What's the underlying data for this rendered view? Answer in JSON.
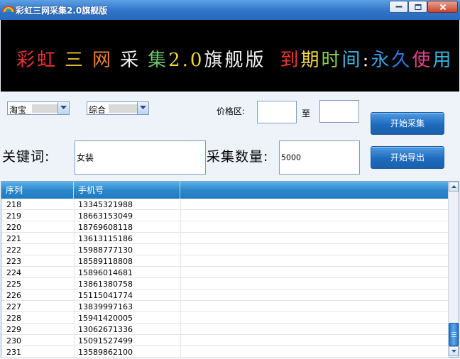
{
  "window": {
    "title": "彩虹三网采集2.0旗舰版"
  },
  "banner": {
    "chars": [
      "彩",
      "虹",
      " ",
      "三",
      " ",
      "网",
      " ",
      "采",
      " ",
      "集",
      "2",
      ".",
      "0",
      "旗",
      "舰",
      "版",
      " ",
      " ",
      "到",
      "期",
      "时",
      "间",
      ":",
      "永",
      "久",
      "使",
      "用"
    ],
    "colors": [
      "#e8322f",
      "#e8322f",
      "#000",
      "#d8b630",
      "#000",
      "#f07e31",
      "#000",
      "#f0f0f0",
      "#000",
      "#6fc36d",
      "#f3d637",
      "#f3d637",
      "#f3d637",
      "#f0f0f0",
      "#f0f0f0",
      "#f0f0f0",
      "#000",
      "#000",
      "#ea3a35",
      "#f4d63a",
      "#8fd24a",
      "#3fb6e5",
      ":",
      "#3b9ee0",
      "#2d7ce0",
      "#e0438a",
      "#3ab3e0"
    ]
  },
  "filters": {
    "platform": "淘宝",
    "category": "综合",
    "price_label": "价格区:",
    "price_min": "",
    "price_to": "至",
    "price_max": ""
  },
  "keyword": {
    "label": "关键词:",
    "value": "女装"
  },
  "count": {
    "label": "采集数量:",
    "value": "5000"
  },
  "buttons": {
    "start_collect": "开始采集",
    "start_export": "开始导出"
  },
  "list": {
    "columns": [
      "序列",
      "手机号",
      ""
    ],
    "rows": [
      [
        "218",
        "13345321988"
      ],
      [
        "219",
        "18663153049"
      ],
      [
        "220",
        "18769608118"
      ],
      [
        "221",
        "13613115186"
      ],
      [
        "222",
        "15988777130"
      ],
      [
        "223",
        "18589118808"
      ],
      [
        "224",
        "15896014681"
      ],
      [
        "225",
        "13861380758"
      ],
      [
        "226",
        "15115041774"
      ],
      [
        "227",
        "13839997163"
      ],
      [
        "228",
        "15941420005"
      ],
      [
        "229",
        "13062671336"
      ],
      [
        "230",
        "15091527499"
      ],
      [
        "231",
        "13589862100"
      ]
    ]
  }
}
